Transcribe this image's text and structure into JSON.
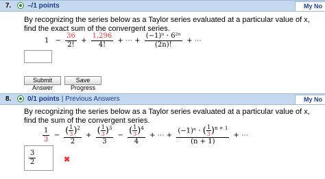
{
  "questions": [
    {
      "number": "7.",
      "points": "–/1 points",
      "my_notes": "My No",
      "prompt": "By recognizing the series below as a Taylor series evaluated at a particular value of x, find the exact sum of the convergent series.",
      "series": {
        "t1": "1",
        "m1": "−",
        "f1_num": "36",
        "f1_den": "2!",
        "p1": "+",
        "f2_num": "1,296",
        "f2_den": "4!",
        "p2": "+ ⋯ +",
        "f3_num": "(−1)ⁿ · 6²ⁿ",
        "f3_den": "(2n)!",
        "p3": "+ ⋯"
      },
      "answer_value": "",
      "buttons": {
        "submit": "Submit Answer",
        "save": "Save Progress"
      }
    },
    {
      "number": "8.",
      "points": "0/1 points",
      "separator": "|",
      "previous_answers": "Previous Answers",
      "my_notes": "My No",
      "prompt": "By recognizing the series below as a Taylor series evaluated at a particular value of x, find the sum of the convergent series.",
      "series": {
        "a_num": "1",
        "a_den": "3",
        "minus": "−",
        "b_den": "2",
        "b_pow": "2",
        "c_den": "3",
        "c_pow": "3",
        "d_den": "4",
        "d_pow": "4",
        "tail": "+ ⋯ +",
        "n_num_pre": "(−1)ⁿ ·",
        "n_pow": "n + 1",
        "n_den": "(n + 1)",
        "end": "+ ⋯",
        "inner_num": "1",
        "inner_den": "3"
      },
      "answer_value": {
        "num": "3",
        "den": "2"
      },
      "status": "incorrect"
    }
  ]
}
